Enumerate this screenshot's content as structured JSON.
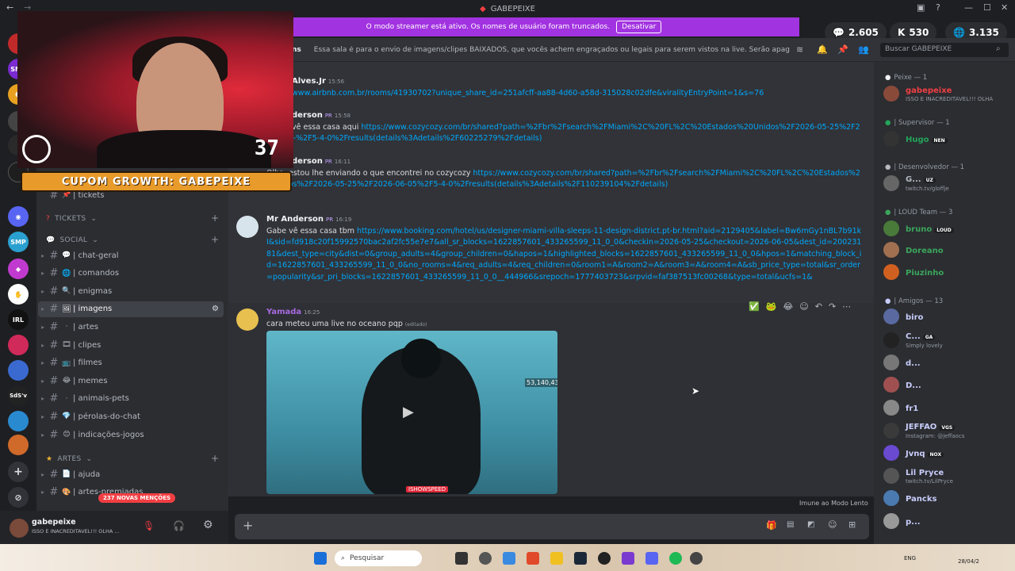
{
  "window": {
    "title": "GABEPEIXE"
  },
  "banner": {
    "message": "O modo streamer está ativo. Os nomes de usuário foram truncados.",
    "button": "Desativar"
  },
  "stats": {
    "viewers": "2.605",
    "kick": "530",
    "globe": "3.135"
  },
  "header": {
    "channel_fragment": "ns",
    "topic": "Essa sala é para o envio de imagens/clipes BAIXADOS, que vocês achem engraçados ou legais para serem vistos na live. Serão apagados prints de o...",
    "search_placeholder": "Buscar GABEPEIXE"
  },
  "webcam": {
    "counter": "37"
  },
  "coupon": {
    "text": "CUPOM GROWTH: GABEPEIXE"
  },
  "sidebar": {
    "tickets_channel": "| tickets",
    "categories": {
      "tickets": "TICKETS",
      "social": "SOCIAL",
      "artes": "ARTES"
    },
    "social_channels": [
      {
        "emoji": "💬",
        "label": "| chat-geral"
      },
      {
        "emoji": "🌐",
        "label": "| comandos"
      },
      {
        "emoji": "🔍",
        "label": "| enigmas"
      },
      {
        "emoji": "🖼",
        "label": "| imagens"
      },
      {
        "emoji": "·",
        "label": "| artes"
      },
      {
        "emoji": "🎞",
        "label": "| clipes"
      },
      {
        "emoji": "📺",
        "label": "| filmes"
      },
      {
        "emoji": "😂",
        "label": "| memes"
      },
      {
        "emoji": "·",
        "label": "| animais-pets"
      },
      {
        "emoji": "💎",
        "label": "| pérolas-do-chat"
      },
      {
        "emoji": "😊",
        "label": "| indicações-jogos"
      }
    ],
    "artes_channels": [
      {
        "emoji": "📄",
        "label": "| ajuda"
      },
      {
        "emoji": "🎨",
        "label": "| artes-premiadas"
      }
    ],
    "mentions_badge": "237 NOVAS MENÇÕES"
  },
  "user_panel": {
    "name": "gabepeixe",
    "status": "ISSO E INACREDITAVEL!!! OLHA ..."
  },
  "messages": [
    {
      "author": "Alves.Jr",
      "time": "15:56",
      "text": "",
      "link": "www.airbnb.com.br/rooms/41930702?unique_share_id=251afcff-aa88-4d60-a58d-315028c02dfe&viralityEntryPoint=1&s=76"
    },
    {
      "author": "derson",
      "badge": "PR",
      "time": "15:58",
      "text": "vê essa casa aqui",
      "link": "https://www.cozycozy.com/br/shared?path=%2Fbr%2Fsearch%2FMiami%2C%20FL%2C%20Estados%20Unidos%2F2026-05-25%2F2026-05-%2F5-4-0%2Fresults(details%3Adetails%2F60225279%2Fdetails)"
    },
    {
      "author": "derson",
      "badge": "PR",
      "time": "16:11",
      "text": "Olha, estou lhe enviando o que encontrei no cozycozy",
      "link": "https://www.cozycozy.com/br/shared?path=%2Fbr%2Fsearch%2FMiami%2C%20FL%2C%20Estados%20Unidos%2F2026-05-25%2F2026-06-05%2F5-4-0%2Fresults(details%3Adetails%2F110239104%2Fdetails)"
    },
    {
      "author": "Mr Anderson",
      "badge": "PR",
      "time": "16:19",
      "text": "Gabe vê essa casa tbm",
      "link": "https://www.booking.com/hotel/us/designer-miami-villa-sleeps-11-design-district.pt-br.html?aid=2129405&label=Bw6mGy1nBL7b91kI&sid=fd918c20f15992570bac2af2fc55e7e7&all_sr_blocks=1622857601_433265599_11_0_0&checkin=2026-05-25&checkout=2026-06-05&dest_id=20023181&dest_type=city&dist=0&group_adults=4&group_children=0&hapos=1&highlighted_blocks=1622857601_433265599_11_0_0&hpos=1&matching_block_id=1622857601_433265599_11_0_0&no_rooms=4&req_adults=4&req_children=0&room1=A&room2=A&room3=A&room4=A&sb_price_type=total&sr_order=popularity&sr_pri_blocks=1622857601_433265599_11_0_0__444966&srepoch=1777403723&srpvid=faf387513fc00268&type=total&ucfs=1&"
    },
    {
      "author": "Yamada",
      "time": "16:25",
      "text": "cara meteu uma live no oceano pqp",
      "edited": "(editado)"
    }
  ],
  "video": {
    "counter": "53,140,432",
    "tag": "ISHOWSPEED"
  },
  "slow_mode": "Imune ao Modo Lento",
  "members": {
    "roles": [
      {
        "name": "Peixe — 1"
      },
      {
        "name": "| Supervisor — 1"
      },
      {
        "name": "| Desenvolvedor — 1"
      },
      {
        "name": "| LOUD Team — 3"
      },
      {
        "name": "| Amigos — 13"
      }
    ],
    "list": [
      {
        "name": "gabepeixe",
        "sub": "ISSO E INACREDITAVEL!!! OLHA",
        "color": "#f23f43"
      },
      {
        "name": "Hugo",
        "badge": "NEN",
        "sub": "",
        "color": "#23a55a"
      },
      {
        "name": "G...",
        "badge": "UZ",
        "sub": "twitch.tv/gloffje",
        "color": "#b5bac1"
      },
      {
        "name": "bruno",
        "badge": "LOUD",
        "sub": "",
        "color": "#3ba55c"
      },
      {
        "name": "Doreano",
        "sub": "",
        "color": "#3ba55c"
      },
      {
        "name": "Piuzinho",
        "sub": "",
        "color": "#3ba55c"
      },
      {
        "name": "biro",
        "sub": "",
        "color": "#c9cdfb"
      },
      {
        "name": "C...",
        "badge": "GA",
        "sub": "Simply lovely",
        "color": "#c9cdfb"
      },
      {
        "name": "d...",
        "sub": "",
        "color": "#c9cdfb"
      },
      {
        "name": "D...",
        "sub": "",
        "color": "#c9cdfb"
      },
      {
        "name": "fr1",
        "sub": "",
        "color": "#c9cdfb"
      },
      {
        "name": "JEFFAO",
        "badge": "VGS",
        "sub": "Instagram: @jeffaocs",
        "color": "#c9cdfb"
      },
      {
        "name": "Jvnq",
        "badge": "NOX",
        "sub": "",
        "color": "#c9cdfb"
      },
      {
        "name": "Lil Pryce",
        "sub": "twitch.tv/LilPryce",
        "color": "#c9cdfb"
      },
      {
        "name": "Pancks",
        "sub": "",
        "color": "#c9cdfb"
      },
      {
        "name": "p...",
        "sub": "",
        "color": "#c9cdfb"
      }
    ]
  },
  "taskbar": {
    "search": "Pesquisar",
    "lang": "ENG",
    "date": "28/04/2"
  }
}
